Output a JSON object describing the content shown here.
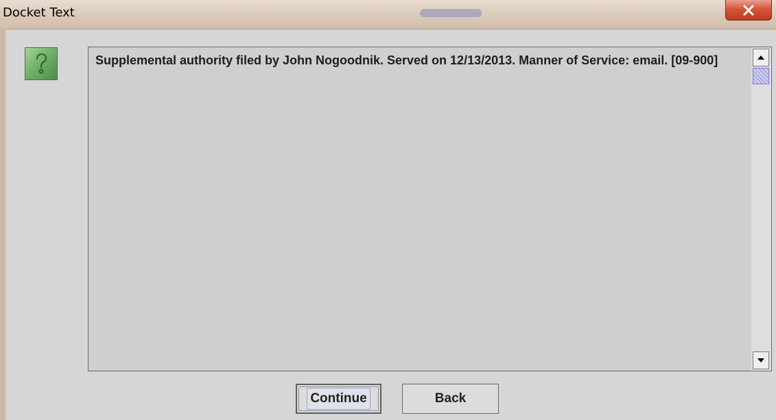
{
  "window": {
    "title": "Docket Text"
  },
  "dialog": {
    "icon": "question-mark-icon",
    "docket_text": "Supplemental authority filed by John Nogoodnik. Served on 12/13/2013. Manner of Service: email. [09-900]"
  },
  "buttons": {
    "continue_label": "Continue",
    "back_label": "Back"
  },
  "colors": {
    "icon_green": "#6eae67",
    "close_red": "#c23a1d",
    "panel_gray": "#cfcfcf"
  }
}
